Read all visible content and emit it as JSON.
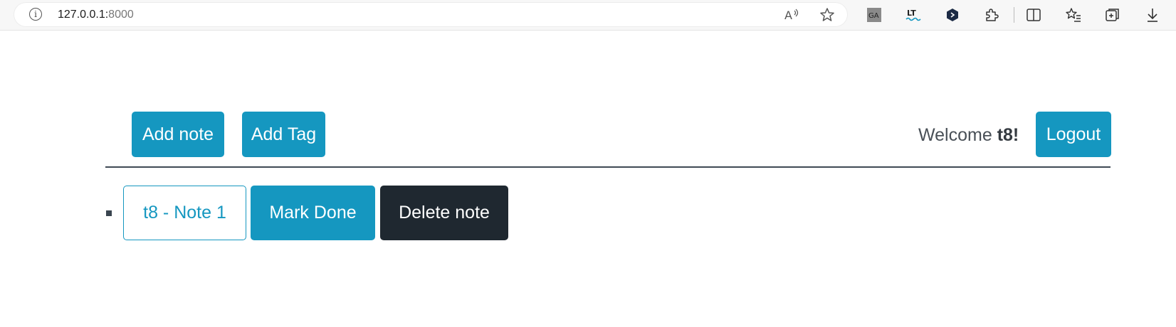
{
  "browser": {
    "url_host": "127.0.0.1:",
    "url_port": "8000"
  },
  "toolbar": {
    "add_note_label": "Add note",
    "add_tag_label": "Add Tag",
    "welcome_prefix": "Welcome ",
    "username": "t8!",
    "logout_label": "Logout"
  },
  "notes": [
    {
      "title": "t8 - Note 1",
      "mark_done_label": "Mark Done",
      "delete_label": "Delete note"
    }
  ],
  "colors": {
    "accent": "#1597c0",
    "dark": "#1f2830"
  }
}
